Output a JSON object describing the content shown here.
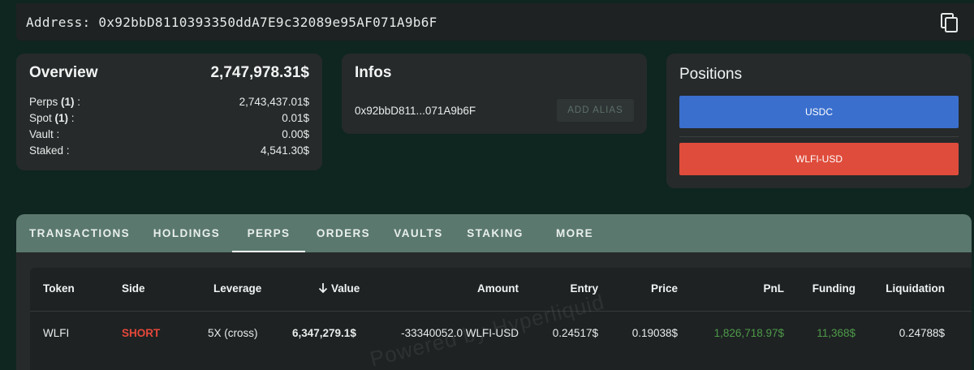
{
  "address_bar": {
    "label": "Address: 0x92bbD8110393350ddA7E9c32089e95AF071A9b6F"
  },
  "overview": {
    "title": "Overview",
    "total": "2,747,978.31$",
    "rows": [
      {
        "label": "Perps ",
        "count": "(1)",
        "suffix": " :",
        "value": "2,743,437.01$"
      },
      {
        "label": "Spot ",
        "count": "(1)",
        "suffix": " :",
        "value": "0.01$"
      },
      {
        "label": "Vault",
        "count": "",
        "suffix": " :",
        "value": "0.00$"
      },
      {
        "label": "Staked",
        "count": "",
        "suffix": " :",
        "value": "4,541.30$"
      }
    ]
  },
  "infos": {
    "title": "Infos",
    "short_address": "0x92bbD811...071A9b6F",
    "add_alias_label": "ADD ALIAS"
  },
  "positions": {
    "title": "Positions",
    "items": [
      {
        "label": "USDC",
        "color": "#3a6fce"
      },
      {
        "label": "WLFI-USD",
        "color": "#df4c3b"
      }
    ]
  },
  "tabs": [
    {
      "label": "TRANSACTIONS"
    },
    {
      "label": "HOLDINGS"
    },
    {
      "label": "PERPS",
      "active": true
    },
    {
      "label": "ORDERS"
    },
    {
      "label": "VAULTS"
    },
    {
      "label": "STAKING"
    },
    {
      "label": "MORE"
    }
  ],
  "table": {
    "headers": [
      "Token",
      "Side",
      "Leverage",
      "Value",
      "Amount",
      "Entry",
      "Price",
      "PnL",
      "Funding",
      "Liquidation"
    ],
    "rows": [
      [
        "WLFI",
        "SHORT",
        "5X (cross)",
        "6,347,279.1$",
        "-33340052.0 WLFI-USD",
        "0.24517$",
        "0.19038$",
        "1,826,718.97$",
        "11,368$",
        "0.24788$"
      ]
    ]
  },
  "watermark": "Powered by Hyperliquid",
  "colors": {
    "background": "#0f2520",
    "tabbar": "#5a786e",
    "short": "#e5483a",
    "positive": "#4e9a48"
  }
}
